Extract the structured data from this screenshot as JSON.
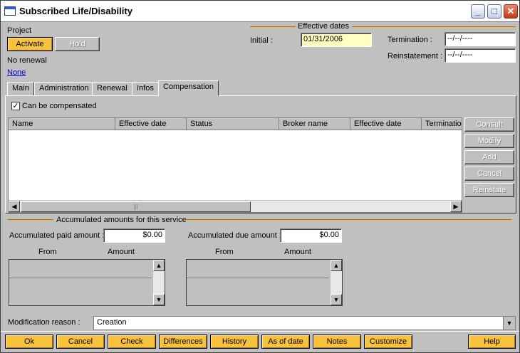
{
  "window": {
    "title": "Subscribed Life/Disability"
  },
  "project": {
    "label": "Project",
    "activate": "Activate",
    "hold": "Hold",
    "renewal": "No renewal",
    "link": "None"
  },
  "effective": {
    "section": "Effective dates",
    "initial_label": "Initial :",
    "initial_value": "01/31/2006",
    "termination_label": "Termination :",
    "termination_value": "--/--/----",
    "reinstatement_label": "Reinstatement :",
    "reinstatement_value": "--/--/----"
  },
  "tabs": [
    {
      "label": "Main"
    },
    {
      "label": "Administration"
    },
    {
      "label": "Renewal"
    },
    {
      "label": "Infos"
    },
    {
      "label": "Compensation"
    }
  ],
  "compensation": {
    "can_be_compensated": "Can be compensated",
    "checked": true,
    "columns": [
      "Name",
      "Effective date",
      "Status",
      "Broker name",
      "Effective date",
      "Terminatio"
    ],
    "side_buttons": [
      "Consult",
      "Modify",
      "Add",
      "Cancel",
      "Reinstate"
    ]
  },
  "accumulated": {
    "section": "Accumulated amounts for this service",
    "paid_label": "Accumulated paid amount :",
    "paid_value": "$0.00",
    "due_label": "Accumulated due amount :",
    "due_value": "$0.00",
    "from_label": "From",
    "amount_label": "Amount"
  },
  "modification": {
    "label": "Modification reason :",
    "value": "Creation"
  },
  "bottom_buttons": [
    "Ok",
    "Cancel",
    "Check",
    "Differences",
    "History",
    "As of date",
    "Notes",
    "Customize",
    "Help"
  ],
  "colors": {
    "orange": "#f9c23c",
    "yellow_field": "#ffffc0",
    "background": "#c0c0c0"
  }
}
